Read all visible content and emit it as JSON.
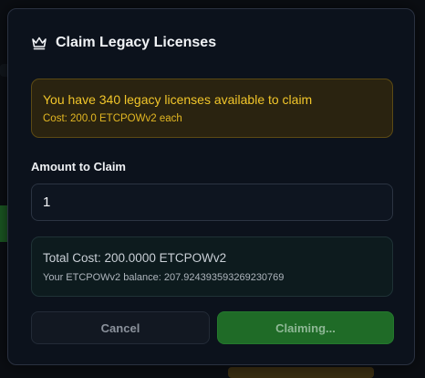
{
  "modal": {
    "title": "Claim Legacy Licenses",
    "icon": "crown-icon"
  },
  "notice": {
    "message": "You have 340 legacy licenses available to claim",
    "cost": "Cost: 200.0 ETCPOWv2 each"
  },
  "form": {
    "amount_label": "Amount to Claim",
    "amount_value": "1"
  },
  "summary": {
    "total": "Total Cost: 200.0000 ETCPOWv2",
    "balance": "Your ETCPOWv2 balance: 207.924393593269230769"
  },
  "actions": {
    "cancel_label": "Cancel",
    "claim_label": "Claiming..."
  },
  "colors": {
    "accent_green": "#1f6b27",
    "warning_yellow": "#f2c62a",
    "modal_bg": "#0c121c"
  }
}
